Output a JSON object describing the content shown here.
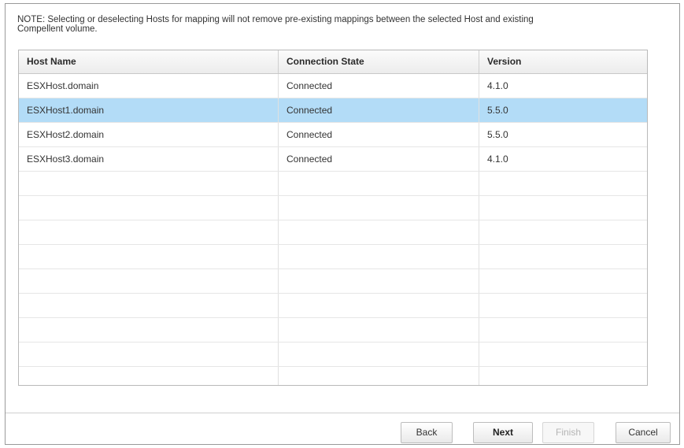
{
  "note": "NOTE: Selecting or deselecting Hosts for mapping will not remove pre-existing mappings between the selected Host and existing Compellent volume.",
  "table": {
    "columns": [
      "Host Name",
      "Connection State",
      "Version"
    ],
    "rows": [
      {
        "host": "ESXHost.domain",
        "state": "Connected",
        "version": "4.1.0",
        "selected": false
      },
      {
        "host": "ESXHost1.domain",
        "state": "Connected",
        "version": "5.5.0",
        "selected": true
      },
      {
        "host": "ESXHost2.domain",
        "state": "Connected",
        "version": "5.5.0",
        "selected": false
      },
      {
        "host": "ESXHost3.domain",
        "state": "Connected",
        "version": "4.1.0",
        "selected": false
      }
    ],
    "empty_rows": 9,
    "selected_color": "#b3dcf7"
  },
  "buttons": {
    "back": "Back",
    "next": "Next",
    "finish": "Finish",
    "cancel": "Cancel",
    "finish_enabled": false
  }
}
